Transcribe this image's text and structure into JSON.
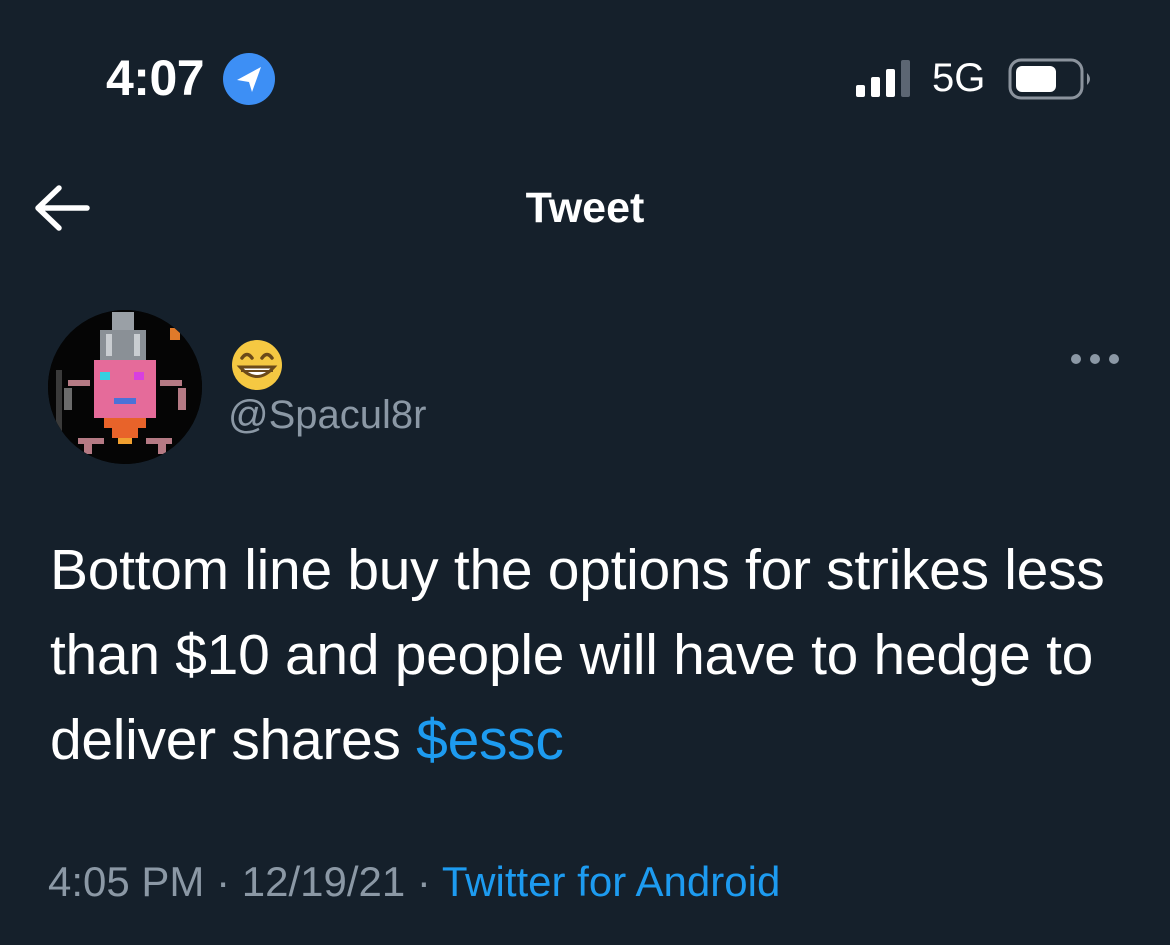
{
  "status_bar": {
    "time": "4:07",
    "network": "5G"
  },
  "header": {
    "title": "Tweet"
  },
  "author": {
    "display_name_emoji": "😁",
    "handle": "@Spacul8r"
  },
  "tweet": {
    "text": "Bottom line buy the options for strikes less than $10 and people will have to hedge to deliver shares ",
    "cashtag": "$essc"
  },
  "meta": {
    "time": "4:05 PM",
    "separator1": " · ",
    "date": "12/19/21",
    "separator2": " · ",
    "source": "Twitter for Android"
  },
  "icons": {
    "location": "location-arrow-icon",
    "signal": "cellular-signal-icon",
    "battery": "battery-icon",
    "back": "back-arrow-icon",
    "more": "more-options-icon"
  },
  "colors": {
    "background": "#15202b",
    "accent": "#1d9bf0",
    "secondary_text": "#8b98a5",
    "primary_text": "#ffffff"
  }
}
